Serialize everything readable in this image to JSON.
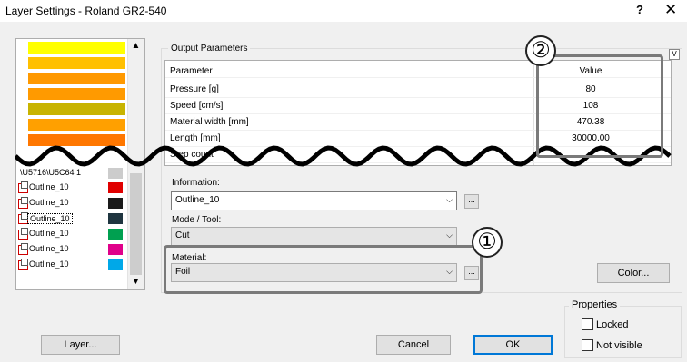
{
  "window": {
    "title": "Layer Settings - Roland GR2-540",
    "help": "?",
    "close": "✕"
  },
  "layers": {
    "swatches": [
      "#ffff00",
      "#ffc000",
      "#ff9900",
      "#ff9a00",
      "#c8b400",
      "#ffa000",
      "#ff7700"
    ],
    "partial_label": "\\U5716\\U5C64 1",
    "items": [
      {
        "label": "Outline_10",
        "color": "#e00000"
      },
      {
        "label": "Outline_10",
        "color": "#1a1a1a"
      },
      {
        "label": "Outline_10",
        "color": "#1f3540"
      },
      {
        "label": "Outline_10",
        "color": "#00a050"
      },
      {
        "label": "Outline_10",
        "color": "#e0008a"
      },
      {
        "label": "Outline_10",
        "color": "#00a8e8"
      }
    ],
    "scroll_up": "▲",
    "scroll_down": "▼"
  },
  "output": {
    "group_label": "Output Parameters",
    "expand": "V",
    "col_parameter": "Parameter",
    "col_value": "Value",
    "rows": [
      {
        "name": "Pressure [g]",
        "value": "80"
      },
      {
        "name": "Speed [cm/s]",
        "value": "108"
      },
      {
        "name": "Material width [mm]",
        "value": "470.38"
      },
      {
        "name": "Length [mm]",
        "value": "30000.00"
      },
      {
        "name": "Step count",
        "value": ""
      }
    ]
  },
  "form": {
    "information_label": "Information:",
    "information_value": "Outline_10",
    "mode_label": "Mode / Tool:",
    "mode_value": "Cut",
    "material_label": "Material:",
    "material_value": "Foil",
    "ellipsis": "...",
    "caret": "⌵",
    "color_button": "Color..."
  },
  "properties": {
    "label": "Properties",
    "locked": "Locked",
    "not_visible": "Not visible"
  },
  "buttons": {
    "layer": "Layer...",
    "cancel": "Cancel",
    "ok": "OK"
  },
  "callouts": {
    "one": "①",
    "two": "②"
  }
}
